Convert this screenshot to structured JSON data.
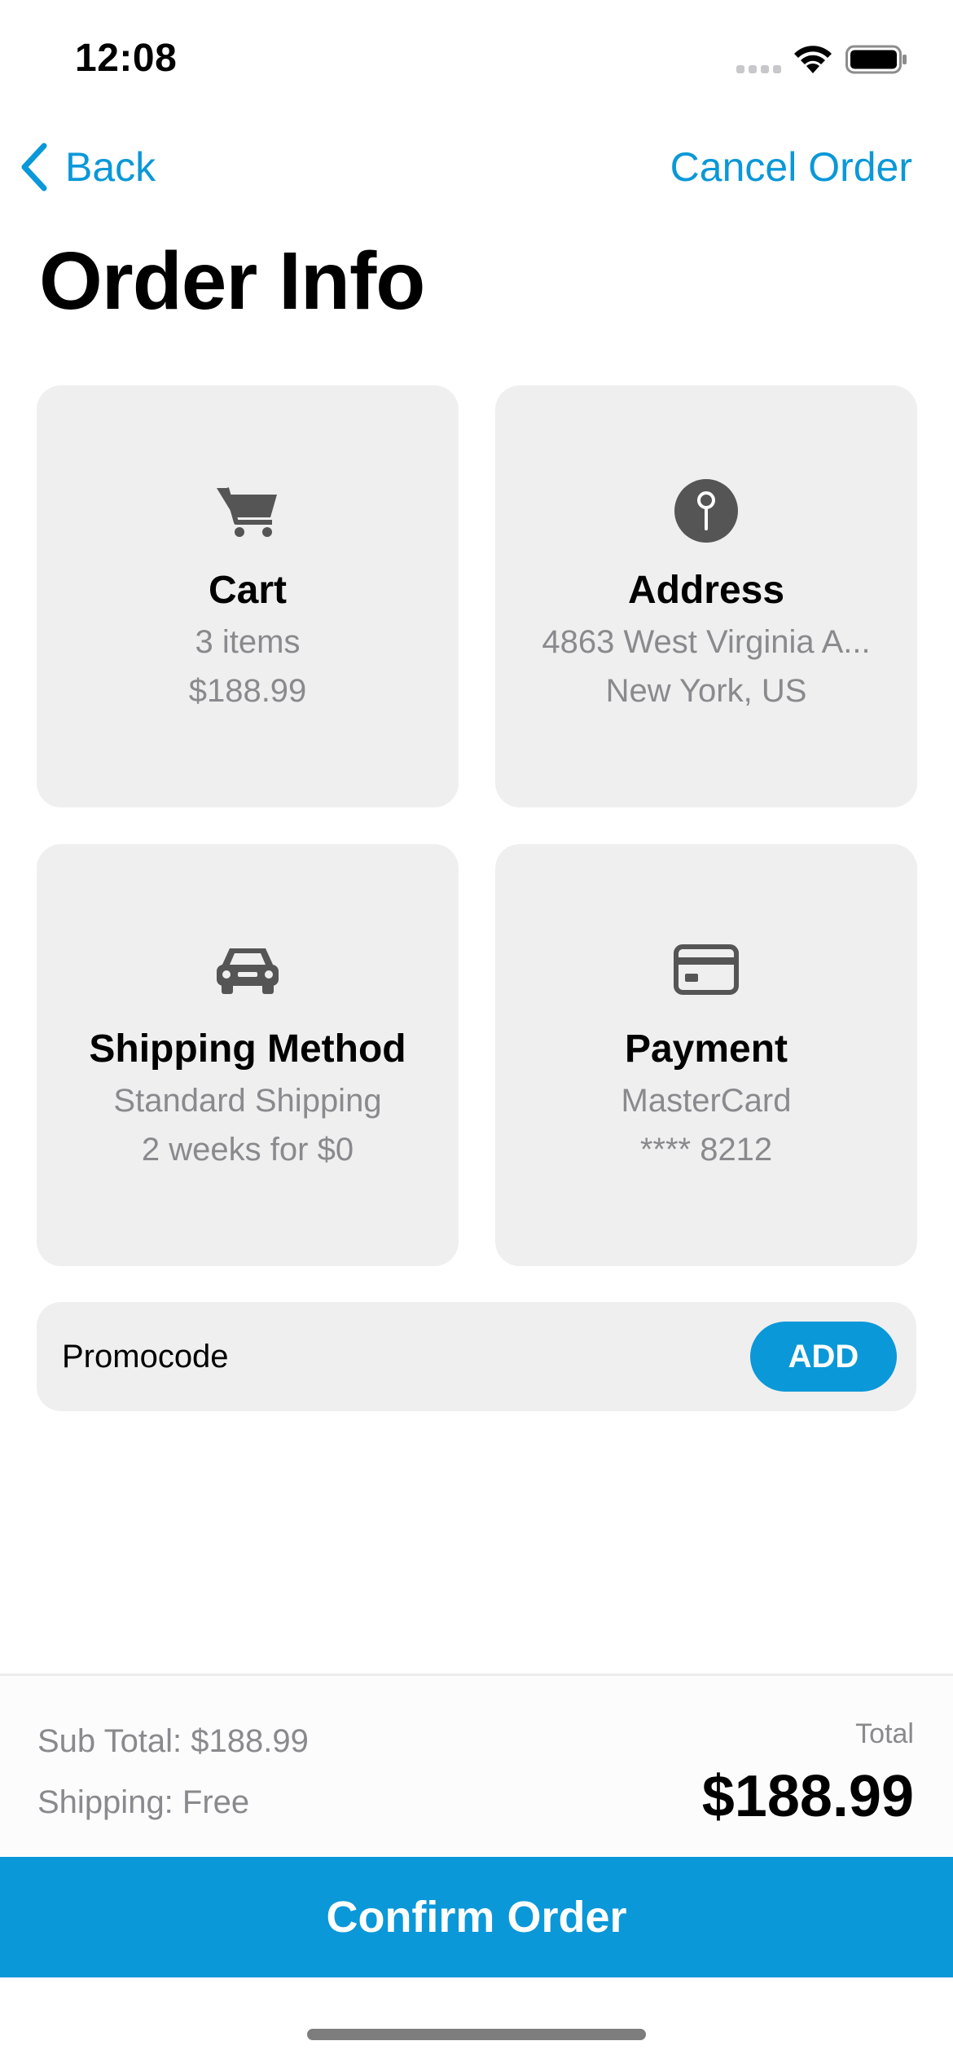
{
  "status_bar": {
    "time": "12:08"
  },
  "nav": {
    "back_label": "Back",
    "cancel_label": "Cancel Order"
  },
  "page": {
    "title": "Order Info"
  },
  "cards": [
    {
      "id": "cart",
      "icon": "cart-icon",
      "title": "Cart",
      "line1": "3 items",
      "line2": "$188.99"
    },
    {
      "id": "address",
      "icon": "pin-icon",
      "title": "Address",
      "line1": "4863  West Virginia A...",
      "line2": "New York, US"
    },
    {
      "id": "shipping",
      "icon": "car-icon",
      "title": "Shipping Method",
      "line1": "Standard Shipping",
      "line2": "2 weeks for $0"
    },
    {
      "id": "payment",
      "icon": "credit-card-icon",
      "title": "Payment",
      "line1": "MasterCard",
      "line2": "**** 8212"
    }
  ],
  "promo": {
    "label": "Promocode",
    "button_label": "ADD"
  },
  "totals": {
    "subtotal": "Sub Total: $188.99",
    "shipping": "Shipping: Free",
    "total_label": "Total",
    "total_value": "$188.99"
  },
  "confirm_label": "Confirm Order",
  "colors": {
    "accent": "#0a98d8",
    "card_bg": "#efefef",
    "secondary_text": "#8a8a8e"
  }
}
